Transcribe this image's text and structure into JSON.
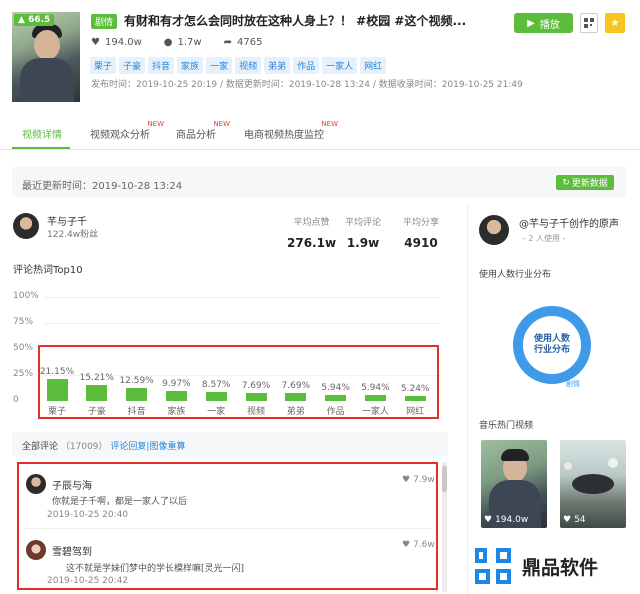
{
  "video": {
    "score": "66.5",
    "category_tag": "剧情",
    "title": "有财和有才怎么会同时放在这种人身上？！ #校园 #这个视频...",
    "likes": "194.0w",
    "comments": "1.7w",
    "shares": "4765",
    "tags": [
      "栗子",
      "子豪",
      "抖音",
      "家族",
      "一家",
      "视频",
      "弟弟",
      "作品",
      "一家人",
      "网红"
    ],
    "times": "发布时间：2019-10-25 20:19 / 数据更新时间：2019-10-28 13:24 / 数据收录时间：2019-10-25 21:49",
    "play_label": "播放"
  },
  "tabs": [
    {
      "label": "视频详情",
      "new": ""
    },
    {
      "label": "视频观众分析",
      "new": "NEW"
    },
    {
      "label": "商品分析",
      "new": "NEW"
    },
    {
      "label": "电商视频热度监控",
      "new": "NEW"
    }
  ],
  "update": {
    "text": "最近更新时间：2019-10-28 13:24",
    "button": "更新数据"
  },
  "author": {
    "name": "芊与子千",
    "fans": "122.4w粉丝",
    "metrics": [
      {
        "label": "平均点赞",
        "value": "276.1w"
      },
      {
        "label": "平均评论",
        "value": "1.9w"
      },
      {
        "label": "平均分享",
        "value": "4910"
      }
    ]
  },
  "chart_data": {
    "type": "bar",
    "title": "评论热词Top10",
    "categories": [
      "栗子",
      "子豪",
      "抖音",
      "家族",
      "一家",
      "视频",
      "弟弟",
      "作品",
      "一家人",
      "网红"
    ],
    "values": [
      21.15,
      15.21,
      12.59,
      9.97,
      8.57,
      7.69,
      7.69,
      5.94,
      5.94,
      5.24
    ],
    "value_labels": [
      "21.15%",
      "15.21%",
      "12.59%",
      "9.97%",
      "8.57%",
      "7.69%",
      "7.69%",
      "5.94%",
      "5.94%",
      "5.24%"
    ],
    "yticks": [
      "100%",
      "75%",
      "50%",
      "25%",
      "0"
    ],
    "ylim": [
      0,
      100
    ],
    "unit": "%",
    "grid": true,
    "color": "#5cbd3c"
  },
  "comments_section": {
    "label": "全部评论",
    "count": "（17009）",
    "link": "评论回复|图像重算"
  },
  "comments": [
    {
      "user": "子辰与海",
      "text": "你就是子千啊，都是一家人了以后",
      "time": "2019-10-25 20:40",
      "likes": "7.9w"
    },
    {
      "user": "雪碧驾到",
      "text": "这不就是学妹们梦中的学长模样嘛[灵光一闪]",
      "time": "2019-10-25 20:42",
      "likes": "7.6w"
    }
  ],
  "music": {
    "name": "@芊与子千创作的原声",
    "users": "- 2 人使用 -",
    "dist_title": "使用人数行业分布",
    "donut_line1": "使用人数",
    "donut_line2": "行业分布",
    "donut_label": "剧情",
    "hot_title": "音乐热门视频",
    "videos": [
      {
        "count": "194.0w"
      },
      {
        "count": "54"
      }
    ]
  },
  "watermark": "鼎品软件"
}
